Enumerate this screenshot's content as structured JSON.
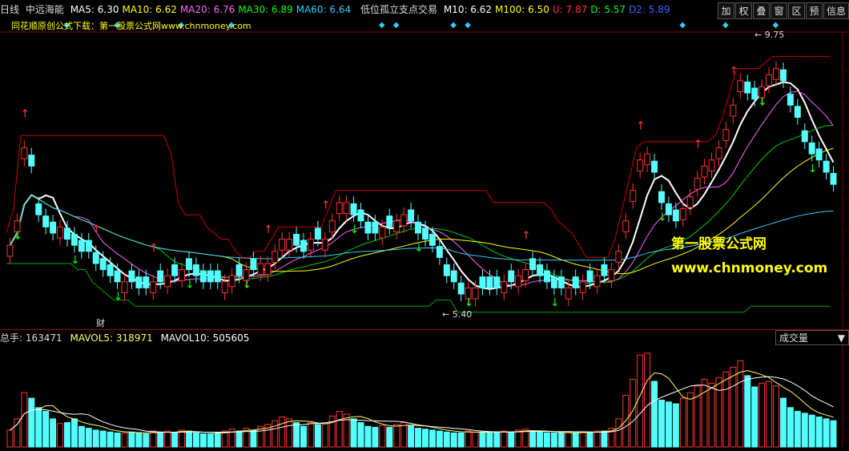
{
  "header": {
    "period": "日线",
    "stock": "中远海能",
    "ma": [
      {
        "label": "MA5: 6.30",
        "color": "#ffffff"
      },
      {
        "label": "MA10: 6.62",
        "color": "#ffff00"
      },
      {
        "label": "MA20: 6.76",
        "color": "#ff66ff"
      },
      {
        "label": "MA30: 6.89",
        "color": "#00ff00"
      },
      {
        "label": "MA60: 6.64",
        "color": "#33ccff"
      }
    ],
    "formula": "低位孤立支点交易",
    "formula_vals": [
      {
        "label": "M10: 6.62",
        "color": "#ffffff"
      },
      {
        "label": "M100: 6.50",
        "color": "#ffff00"
      },
      {
        "label": "U: 7.87",
        "color": "#ff3333"
      },
      {
        "label": "D: 5.57",
        "color": "#00ff00"
      },
      {
        "label": "D2: 5.89",
        "color": "#3366ff"
      }
    ],
    "subtitle": "同花顺原创公式下载：第一股票公式网www.chnmoney.com"
  },
  "toolbar": {
    "buttons": [
      "加",
      "权",
      "叠",
      "窗",
      "区",
      "预",
      "信息"
    ]
  },
  "annotations": {
    "high": "9.75",
    "low": "5.40",
    "cai": "财"
  },
  "watermark": {
    "line1": "第一股票公式网",
    "line2": "www.chnmoney.com"
  },
  "volume": {
    "label": "总手: 163471",
    "mavol5": "MAVOL5: 318971",
    "mavol10": "MAVOL10: 505605",
    "selector": "成交量"
  },
  "chart_data": {
    "type": "candlestick",
    "close": [
      6.5,
      6.9,
      8.1,
      7.8,
      7.0,
      6.8,
      6.7,
      6.8,
      6.6,
      6.5,
      6.4,
      6.4,
      6.2,
      6.1,
      6.0,
      5.9,
      5.9,
      5.9,
      5.8,
      5.8,
      5.9,
      5.9,
      6.0,
      6.0,
      6.1,
      6.1,
      6.0,
      5.9,
      5.9,
      5.9,
      5.9,
      6.0,
      6.0,
      6.1,
      6.1,
      6.2,
      6.2,
      6.4,
      6.6,
      6.6,
      6.5,
      6.4,
      6.6,
      6.6,
      6.6,
      6.9,
      7.2,
      7.2,
      7.0,
      6.9,
      6.7,
      6.7,
      6.8,
      6.8,
      6.9,
      7.0,
      6.9,
      6.7,
      6.6,
      6.5,
      6.3,
      6.0,
      5.9,
      5.7,
      5.8,
      5.8,
      5.8,
      5.8,
      5.8,
      5.9,
      5.9,
      6.0,
      6.1,
      6.1,
      6.0,
      5.9,
      5.8,
      5.8,
      5.8,
      5.8,
      5.9,
      5.9,
      6.0,
      6.0,
      6.1,
      6.4,
      6.9,
      7.4,
      7.9,
      8.0,
      7.7,
      7.2,
      7.0,
      6.9,
      7.1,
      7.3,
      7.6,
      7.8,
      7.9,
      8.1,
      8.4,
      8.8,
      9.2,
      9.0,
      8.9,
      9.1,
      9.3,
      9.4,
      9.2,
      8.8,
      8.6,
      8.2,
      8.0,
      7.9,
      7.7,
      7.5
    ],
    "up": [
      1,
      1,
      1,
      0,
      0,
      0,
      0,
      1,
      0,
      0,
      0,
      0,
      0,
      0,
      0,
      0,
      1,
      0,
      0,
      0,
      1,
      0,
      1,
      0,
      1,
      0,
      0,
      0,
      0,
      0,
      1,
      1,
      0,
      1,
      0,
      1,
      1,
      1,
      1,
      1,
      0,
      0,
      1,
      0,
      1,
      1,
      1,
      1,
      0,
      0,
      0,
      0,
      1,
      0,
      1,
      1,
      0,
      0,
      0,
      0,
      0,
      0,
      0,
      0,
      1,
      1,
      0,
      0,
      0,
      1,
      0,
      1,
      1,
      0,
      0,
      0,
      0,
      0,
      1,
      0,
      1,
      0,
      1,
      0,
      1,
      1,
      1,
      1,
      1,
      1,
      0,
      0,
      0,
      0,
      1,
      1,
      1,
      1,
      1,
      1,
      1,
      1,
      1,
      0,
      0,
      1,
      1,
      1,
      0,
      0,
      0,
      0,
      0,
      0,
      0,
      0
    ],
    "volume": [
      180,
      300,
      580,
      520,
      420,
      380,
      300,
      250,
      260,
      300,
      220,
      200,
      180,
      170,
      160,
      150,
      150,
      160,
      150,
      140,
      170,
      160,
      170,
      150,
      180,
      170,
      150,
      140,
      140,
      150,
      170,
      190,
      170,
      200,
      180,
      220,
      240,
      280,
      320,
      300,
      260,
      220,
      260,
      240,
      250,
      330,
      380,
      350,
      300,
      260,
      220,
      210,
      230,
      210,
      240,
      260,
      230,
      200,
      190,
      180,
      170,
      160,
      150,
      150,
      170,
      160,
      160,
      150,
      160,
      170,
      160,
      180,
      190,
      170,
      160,
      150,
      150,
      150,
      160,
      150,
      160,
      160,
      170,
      170,
      200,
      300,
      550,
      720,
      980,
      1000,
      700,
      500,
      480,
      460,
      520,
      580,
      650,
      720,
      680,
      740,
      800,
      850,
      920,
      760,
      640,
      680,
      700,
      650,
      520,
      420,
      380,
      360,
      340,
      320,
      300,
      280
    ],
    "xlabel": "",
    "ylabel": ""
  }
}
